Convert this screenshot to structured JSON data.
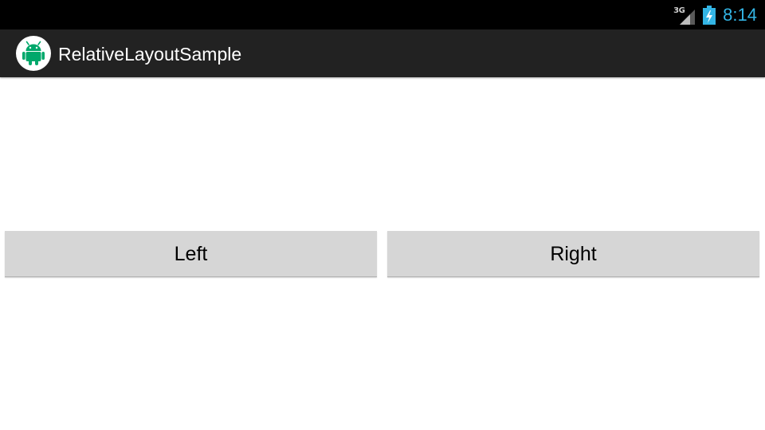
{
  "status_bar": {
    "network_type": "3G",
    "time": "8:14",
    "time_color": "#33b5e5",
    "icons": [
      "signal-icon",
      "battery-charging-icon"
    ]
  },
  "action_bar": {
    "title": "RelativeLayoutSample",
    "icon": "android-robot-icon",
    "icon_color": "#00a86b"
  },
  "buttons": {
    "left_label": "Left",
    "right_label": "Right"
  }
}
